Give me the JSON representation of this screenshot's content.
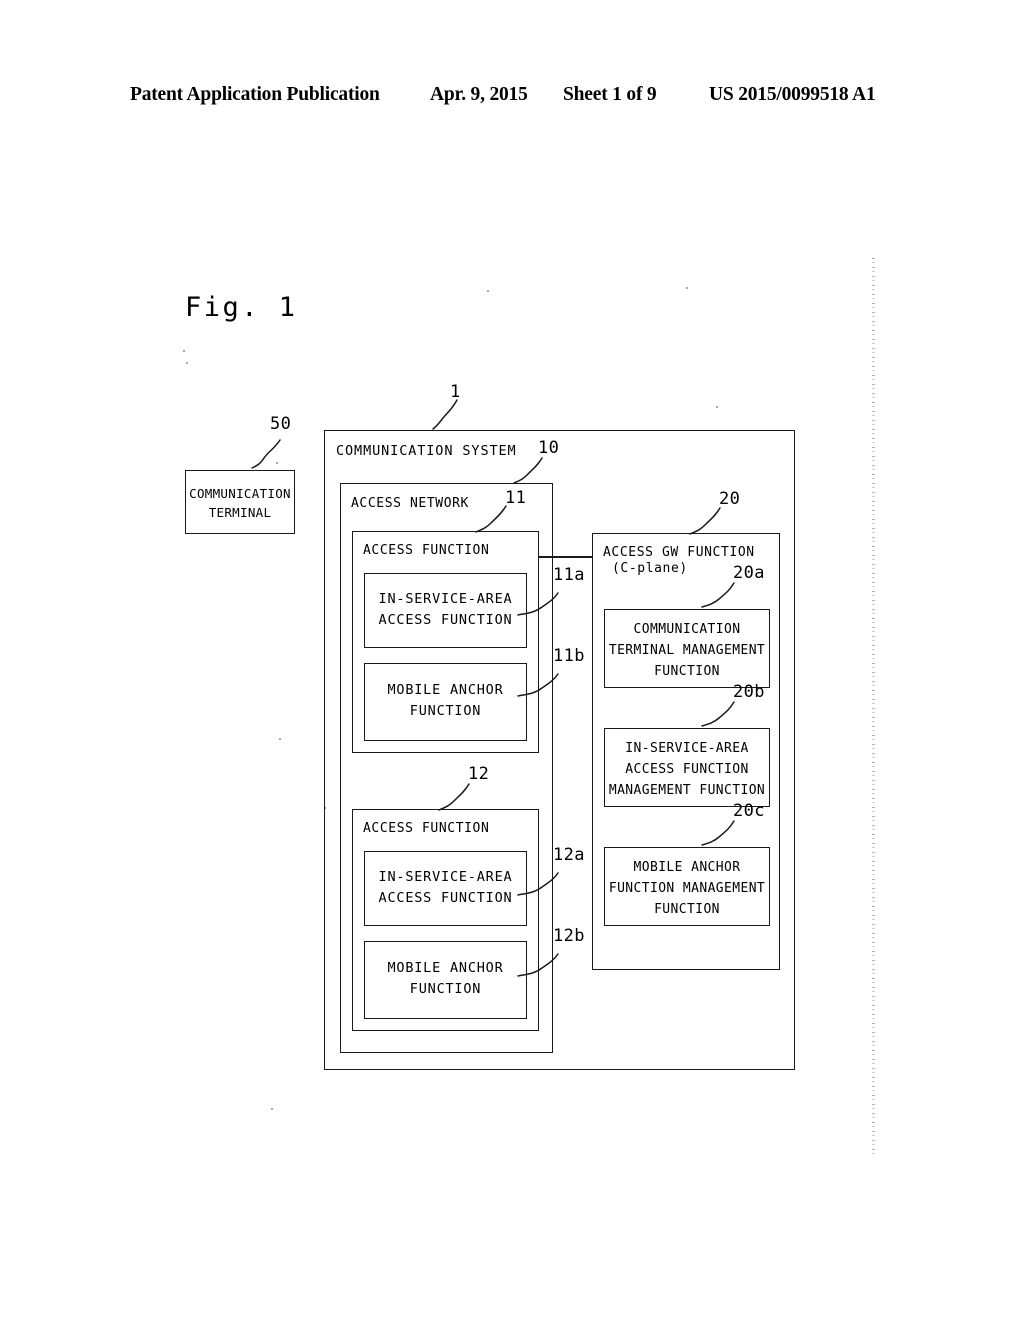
{
  "header": {
    "publication": "Patent Application Publication",
    "date": "Apr. 9, 2015",
    "sheet": "Sheet 1 of 9",
    "number": "US 2015/0099518 A1"
  },
  "figure": {
    "label": "Fig. 1"
  },
  "terminal": {
    "ref": "50",
    "label": "COMMUNICATION\nTERMINAL"
  },
  "system": {
    "ref": "1",
    "title": "COMMUNICATION SYSTEM"
  },
  "access_network": {
    "ref": "10",
    "title": "ACCESS NETWORK"
  },
  "access_function_1": {
    "ref": "11",
    "title": "ACCESS FUNCTION",
    "children": [
      {
        "ref": "11a",
        "label": "IN-SERVICE-AREA\nACCESS FUNCTION"
      },
      {
        "ref": "11b",
        "label": "MOBILE ANCHOR\nFUNCTION"
      }
    ]
  },
  "access_function_2": {
    "ref": "12",
    "title": "ACCESS FUNCTION",
    "children": [
      {
        "ref": "12a",
        "label": "IN-SERVICE-AREA\nACCESS FUNCTION"
      },
      {
        "ref": "12b",
        "label": "MOBILE ANCHOR\nFUNCTION"
      }
    ]
  },
  "access_gw": {
    "ref": "20",
    "title_line1": "ACCESS GW FUNCTION",
    "title_line2": "(C-plane)",
    "children": [
      {
        "ref": "20a",
        "label": "COMMUNICATION\nTERMINAL MANAGEMENT\nFUNCTION"
      },
      {
        "ref": "20b",
        "label": "IN-SERVICE-AREA\nACCESS FUNCTION\nMANAGEMENT FUNCTION"
      },
      {
        "ref": "20c",
        "label": "MOBILE ANCHOR\nFUNCTION MANAGEMENT\nFUNCTION"
      }
    ]
  },
  "colors": {
    "ink": "#1a1a1a",
    "paper": "#ffffff"
  }
}
